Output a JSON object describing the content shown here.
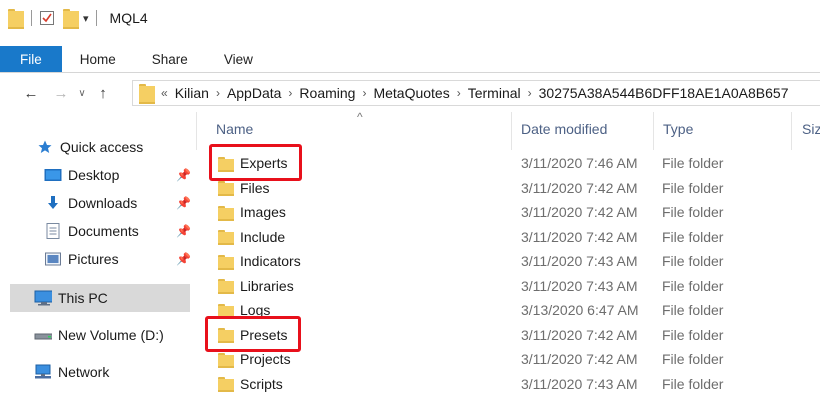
{
  "window": {
    "title": "MQL4"
  },
  "ribbon": {
    "tabs": [
      "File",
      "Home",
      "Share",
      "View"
    ]
  },
  "nav": {
    "back_icon": "arrow-left-icon",
    "forward_icon": "arrow-right-icon",
    "recent_icon": "chevron-down-icon",
    "up_icon": "arrow-up-icon",
    "path": [
      "Kilian",
      "AppData",
      "Roaming",
      "MetaQuotes",
      "Terminal",
      "30275A38A544B6DFF18AE1A0A8B657"
    ]
  },
  "sidebar": {
    "items": [
      {
        "label": "Quick access",
        "icon": "star-icon"
      },
      {
        "label": "Desktop",
        "icon": "desktop-icon",
        "pinned": true
      },
      {
        "label": "Downloads",
        "icon": "download-icon",
        "pinned": true
      },
      {
        "label": "Documents",
        "icon": "document-icon",
        "pinned": true
      },
      {
        "label": "Pictures",
        "icon": "pictures-icon",
        "pinned": true
      },
      {
        "label": "This PC",
        "icon": "computer-icon",
        "selected": true
      },
      {
        "label": "New Volume (D:)",
        "icon": "drive-icon"
      },
      {
        "label": "Network",
        "icon": "network-icon"
      }
    ]
  },
  "columns": {
    "name": "Name",
    "date": "Date modified",
    "type": "Type",
    "size": "Siz"
  },
  "files": [
    {
      "name": "Experts",
      "date": "3/11/2020 7:46 AM",
      "type": "File folder",
      "highlighted": true
    },
    {
      "name": "Files",
      "date": "3/11/2020 7:42 AM",
      "type": "File folder"
    },
    {
      "name": "Images",
      "date": "3/11/2020 7:42 AM",
      "type": "File folder"
    },
    {
      "name": "Include",
      "date": "3/11/2020 7:42 AM",
      "type": "File folder"
    },
    {
      "name": "Indicators",
      "date": "3/11/2020 7:43 AM",
      "type": "File folder"
    },
    {
      "name": "Libraries",
      "date": "3/11/2020 7:43 AM",
      "type": "File folder"
    },
    {
      "name": "Logs",
      "date": "3/13/2020 6:47 AM",
      "type": "File folder"
    },
    {
      "name": "Presets",
      "date": "3/11/2020 7:42 AM",
      "type": "File folder",
      "highlighted": true
    },
    {
      "name": "Projects",
      "date": "3/11/2020 7:42 AM",
      "type": "File folder"
    },
    {
      "name": "Scripts",
      "date": "3/11/2020 7:43 AM",
      "type": "File folder"
    }
  ],
  "colors": {
    "accent": "#1979ca",
    "highlight_box": "#e8101b",
    "folder": "#f5cf63"
  }
}
